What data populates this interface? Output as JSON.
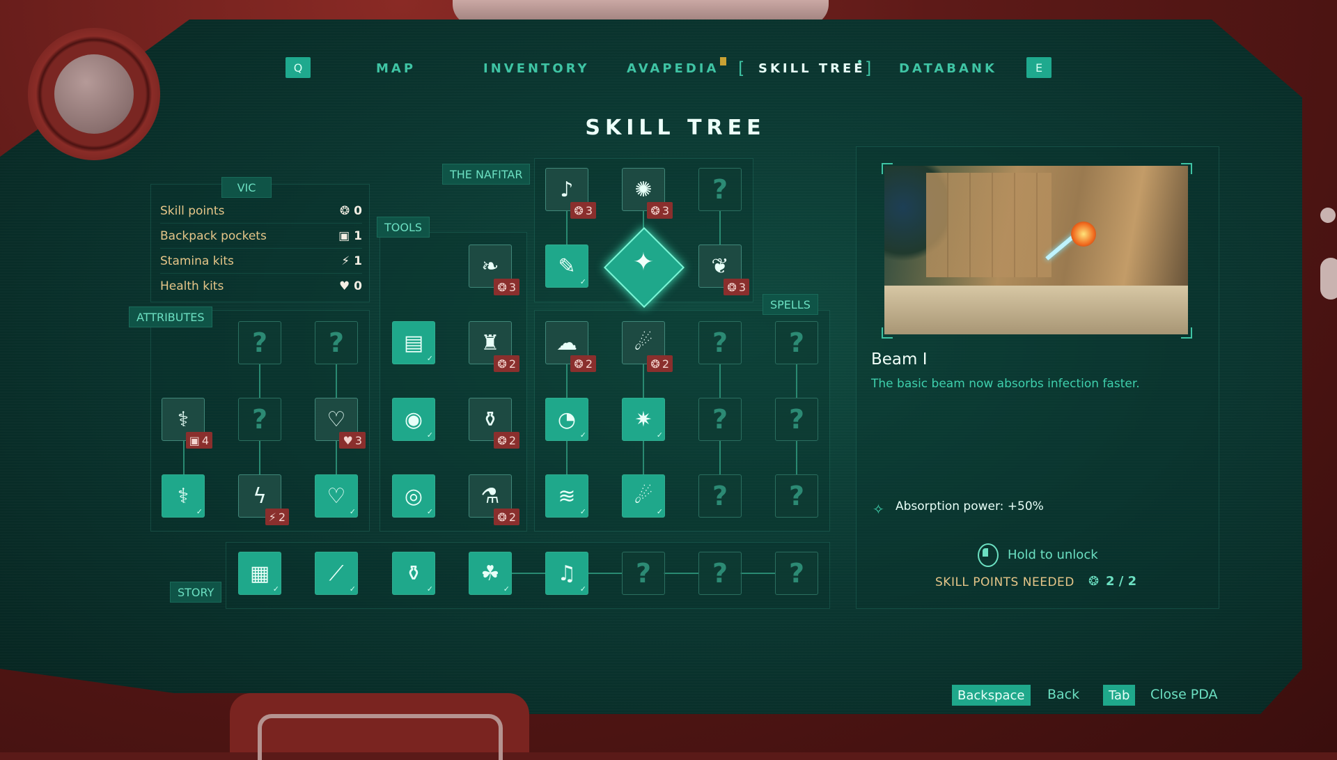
{
  "nav": {
    "key_left": "Q",
    "key_right": "E",
    "items": [
      "MAP",
      "INVENTORY",
      "AVAPEDIA",
      "SKILL TREE",
      "DATABANK"
    ],
    "open_bracket": "[",
    "close_bracket": "]"
  },
  "title": "SKILL TREE",
  "sections": {
    "vic": "VIC",
    "nafitar": "THE NAFITAR",
    "tools": "TOOLS",
    "spells": "SPELLS",
    "attributes": "ATTRIBUTES",
    "story": "STORY"
  },
  "stats": [
    {
      "label": "Skill points",
      "icon": "skill-point-icon",
      "glyph": "❂",
      "value": "0"
    },
    {
      "label": "Backpack pockets",
      "icon": "backpack-icon",
      "glyph": "▣",
      "value": "1"
    },
    {
      "label": "Stamina kits",
      "icon": "stamina-icon",
      "glyph": "⚡",
      "value": "1"
    },
    {
      "label": "Health kits",
      "icon": "heart-icon",
      "glyph": "♥",
      "value": "0"
    }
  ],
  "locked_glyph": "?",
  "costs": {
    "nafitar_a": "3",
    "nafitar_b": "3",
    "nafitar_c": "3",
    "tools_top": "3",
    "tools_r1": "2",
    "tools_r2": "2",
    "tools_r3": "2",
    "spells_a": "2",
    "spells_b": "2",
    "attr_backpack": "4",
    "attr_heart": "3",
    "attr_stamina": "2"
  },
  "selected_skill": {
    "name": "Beam I",
    "description": "The basic beam now absorbs infection faster.",
    "bonus": "Absorption power: +50%",
    "action": "Hold to unlock",
    "points_label": "SKILL POINTS NEEDED",
    "points_value": "2 / 2"
  },
  "hints": [
    {
      "key": "Backspace",
      "label": "Back"
    },
    {
      "key": "Tab",
      "label": "Close PDA"
    }
  ],
  "colors": {
    "accent": "#1fa88b",
    "text_teal": "#3fc4a4",
    "gold": "#e6c689",
    "cost_red": "#8a2f2d"
  }
}
